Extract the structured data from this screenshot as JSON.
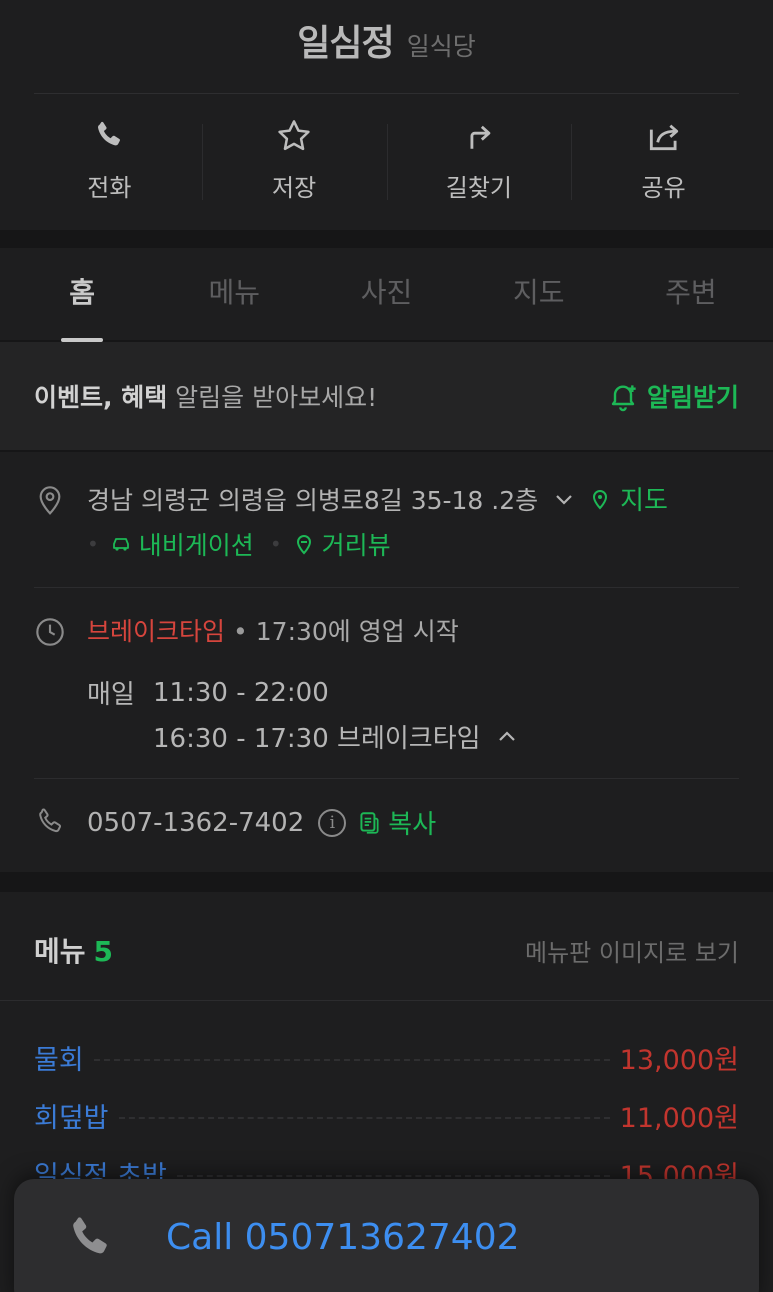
{
  "header": {
    "name": "일심정",
    "category": "일식당",
    "actions": [
      {
        "label": "전화",
        "icon": "phone-icon"
      },
      {
        "label": "저장",
        "icon": "star-icon"
      },
      {
        "label": "길찾기",
        "icon": "directions-icon"
      },
      {
        "label": "공유",
        "icon": "share-icon"
      }
    ]
  },
  "tabs": [
    {
      "label": "홈",
      "active": true
    },
    {
      "label": "메뉴",
      "active": false
    },
    {
      "label": "사진",
      "active": false
    },
    {
      "label": "지도",
      "active": false
    },
    {
      "label": "주변",
      "active": false
    }
  ],
  "event_banner": {
    "bold": "이벤트, 혜택",
    "rest": " 알림을 받아보세요!",
    "button": "알림받기"
  },
  "info": {
    "address": "경남 의령군 의령읍 의병로8길 35-18 .2층",
    "map_link": "지도",
    "navigation_link": "내비게이션",
    "streetview_link": "거리뷰",
    "status": "브레이크타임",
    "status_detail": "17:30에 영업 시작",
    "hours_day": "매일",
    "hours_open": "11:30 - 22:00",
    "hours_break": "16:30 - 17:30 브레이크타임",
    "phone": "0507-1362-7402",
    "copy_label": "복사"
  },
  "menu": {
    "title": "메뉴",
    "count": "5",
    "view_board": "메뉴판 이미지로 보기",
    "items": [
      {
        "name": "물회",
        "price": "13,000원"
      },
      {
        "name": "회덮밥",
        "price": "11,000원"
      },
      {
        "name": "일심정 초밥",
        "price": "15,000원"
      }
    ]
  },
  "call_sheet": {
    "label": "Call 050713627402"
  },
  "colors": {
    "accent_green": "#1db856",
    "status_red": "#d6453d",
    "link_blue": "#3d8ef0",
    "price_red": "#c2352e"
  }
}
